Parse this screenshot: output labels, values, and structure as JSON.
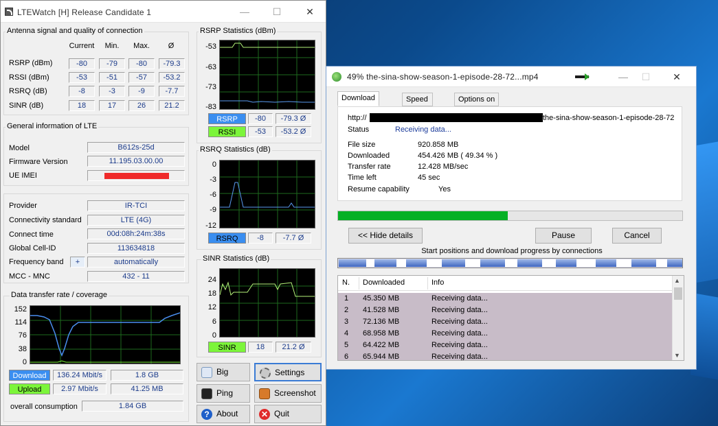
{
  "lte": {
    "title": "LTEWatch [H]   Release Candidate 1",
    "antenna": {
      "title": "Antenna signal and quality of connection",
      "headers": [
        "Current",
        "Min.",
        "Max.",
        "Ø"
      ],
      "rows": [
        {
          "label": "RSRP (dBm)",
          "values": [
            "-80",
            "-79",
            "-80",
            "-79.3"
          ]
        },
        {
          "label": "RSSI (dBm)",
          "values": [
            "-53",
            "-51",
            "-57",
            "-53.2"
          ]
        },
        {
          "label": "RSRQ (dB)",
          "values": [
            "-8",
            "-3",
            "-9",
            "-7.7"
          ]
        },
        {
          "label": "SINR (dB)",
          "values": [
            "18",
            "17",
            "26",
            "21.2"
          ]
        }
      ]
    },
    "general": {
      "title": "General information of LTE",
      "model_label": "Model",
      "model": "B612s-25d",
      "firmware_label": "Firmware Version",
      "firmware": "11.195.03.00.00",
      "imei_label": "UE IMEI"
    },
    "provider": {
      "provider_label": "Provider",
      "provider": "IR-TCI",
      "standard_label": "Connectivity standard",
      "standard": "LTE (4G)",
      "connect_label": "Connect time",
      "connect": "00d:08h:24m:38s",
      "cell_label": "Global Cell-ID",
      "cell": "113634818",
      "band_label": "Frequency band",
      "band_button": "+",
      "band": "automatically",
      "mcc_label": "MCC - MNC",
      "mcc": "432 - 11"
    },
    "transfer": {
      "title": "Data transfer rate / coverage",
      "yticks": [
        "152",
        "114",
        "76",
        "38",
        "0"
      ],
      "download_label": "Download",
      "download_rate": "136.24 Mbit/s",
      "download_total": "1.8 GB",
      "upload_label": "Upload",
      "upload_rate": "2.97 Mbit/s",
      "upload_total": "41.25 MB",
      "overall_label": "overall consumption",
      "overall": "1.84 GB"
    },
    "rsrp_stats": {
      "title": "RSRP Statistics (dBm)",
      "yticks": [
        "-53",
        "-63",
        "-73",
        "-83"
      ],
      "tag": "RSRP",
      "cur": "-80",
      "avg": "-79.3 Ø"
    },
    "rssi_stats": {
      "tag": "RSSI",
      "cur": "-53",
      "avg": "-53.2 Ø"
    },
    "rsrq_stats": {
      "title": "RSRQ Statistics (dB)",
      "yticks": [
        "0",
        "-3",
        "-6",
        "-9",
        "-12"
      ],
      "tag": "RSRQ",
      "cur": "-8",
      "avg": "-7.7 Ø"
    },
    "sinr_stats": {
      "title": "SINR Statistics (dB)",
      "yticks": [
        "24",
        "18",
        "12",
        "6",
        "0"
      ],
      "tag": "SINR",
      "cur": "18",
      "avg": "21.2 Ø"
    },
    "buttons": {
      "bigmode": "Big Mode",
      "settings": "Settings",
      "ping": "Ping Tool",
      "screenshot": "Screenshot",
      "about": "About",
      "quit": "Quit"
    },
    "colors": {
      "rsrp": "#3a8ef0",
      "rssi": "#7cf53a",
      "green_line": "#b6f57a",
      "blue_line": "#5a9af0"
    }
  },
  "download": {
    "title": "49% the-sina-show-season-1-episode-28-72...mp4",
    "tabs": [
      "Download status",
      "Speed Limiter",
      "Options on completion"
    ],
    "url_prefix": "http://",
    "url_suffix": "the-sina-show-season-1-episode-28-72",
    "status_label": "Status",
    "status": "Receiving data...",
    "size_label": "File size",
    "size": "920.858  MB",
    "downloaded_label": "Downloaded",
    "downloaded": "454.426  MB  ( 49.34 % )",
    "rate_label": "Transfer rate",
    "rate": "12.428  MB/sec",
    "timeleft_label": "Time left",
    "timeleft": "45 sec",
    "resume_label": "Resume capability",
    "resume": "Yes",
    "progress": 0.4934,
    "hide_button": "<< Hide details",
    "pause_button": "Pause",
    "cancel_button": "Cancel",
    "connections_title": "Start positions and download progress by connections",
    "table": {
      "headers": [
        "N.",
        "Downloaded",
        "Info"
      ],
      "rows": [
        [
          "1",
          "45.350  MB",
          "Receiving data..."
        ],
        [
          "2",
          "41.528  MB",
          "Receiving data..."
        ],
        [
          "3",
          "72.136  MB",
          "Receiving data..."
        ],
        [
          "4",
          "68.958  MB",
          "Receiving data..."
        ],
        [
          "5",
          "64.422  MB",
          "Receiving data..."
        ],
        [
          "6",
          "65.944  MB",
          "Receiving data..."
        ]
      ]
    }
  }
}
